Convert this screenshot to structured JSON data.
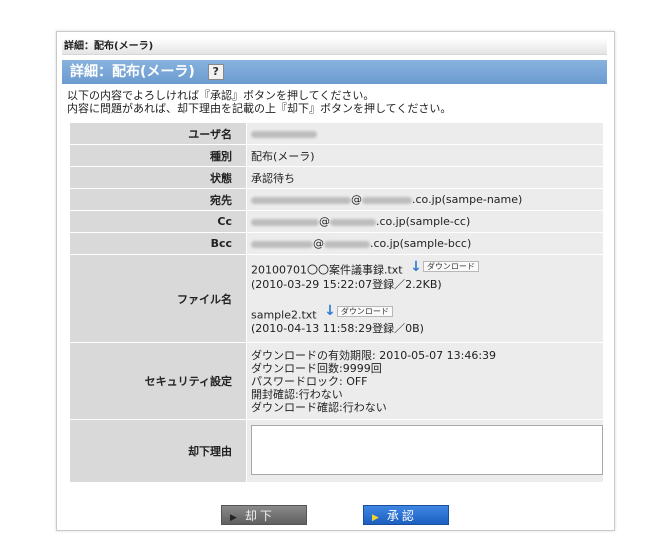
{
  "breadcrumb": "詳細：配布(メーラ)",
  "title": "詳細：配布(メーラ)",
  "help_icon_label": "?",
  "intro": [
    "以下の内容でよろしければ『承認』ボタンを押してください。",
    "内容に問題があれば、却下理由を記載の上『却下』ボタンを押してください。"
  ],
  "rows": {
    "user": {
      "label": "ユーザ名"
    },
    "type": {
      "label": "種別",
      "value": "配布(メーラ)"
    },
    "status": {
      "label": "状態",
      "value": "承認待ち"
    },
    "to": {
      "label": "宛先",
      "domain": "@",
      "suffix": ".co.jp(sampe-name)"
    },
    "cc": {
      "label": "Cc",
      "domain": "@",
      "suffix": ".co.jp(sample-cc)"
    },
    "bcc": {
      "label": "Bcc",
      "domain": "@",
      "suffix": ".co.jp(sample-bcc)"
    },
    "files": {
      "label": "ファイル名",
      "download_label": "ダウンロード",
      "items": [
        {
          "name": "20100701〇〇案件議事録.txt",
          "meta": "(2010-03-29 15:22:07登録／2.2KB)"
        },
        {
          "name": "sample2.txt",
          "meta": "(2010-04-13 11:58:29登録／0B)"
        }
      ]
    },
    "security": {
      "label": "セキュリティ設定",
      "lines": [
        "ダウンロードの有効期限: 2010-05-07 13:46:39",
        "ダウンロード回数:9999回",
        "パスワードロック: OFF",
        "開封確認:行わない",
        "ダウンロード確認:行わない"
      ]
    },
    "reason": {
      "label": "却下理由",
      "value": ""
    }
  },
  "buttons": {
    "reject": "却下",
    "approve": "承認"
  },
  "colors": {
    "title_bar": "#7aa7d8",
    "label_cell": "#d9d9d9",
    "value_cell": "#ececec",
    "approve_button": "#2a6fd0",
    "reject_button": "#737373",
    "download_arrow": "#2d7cd6"
  }
}
